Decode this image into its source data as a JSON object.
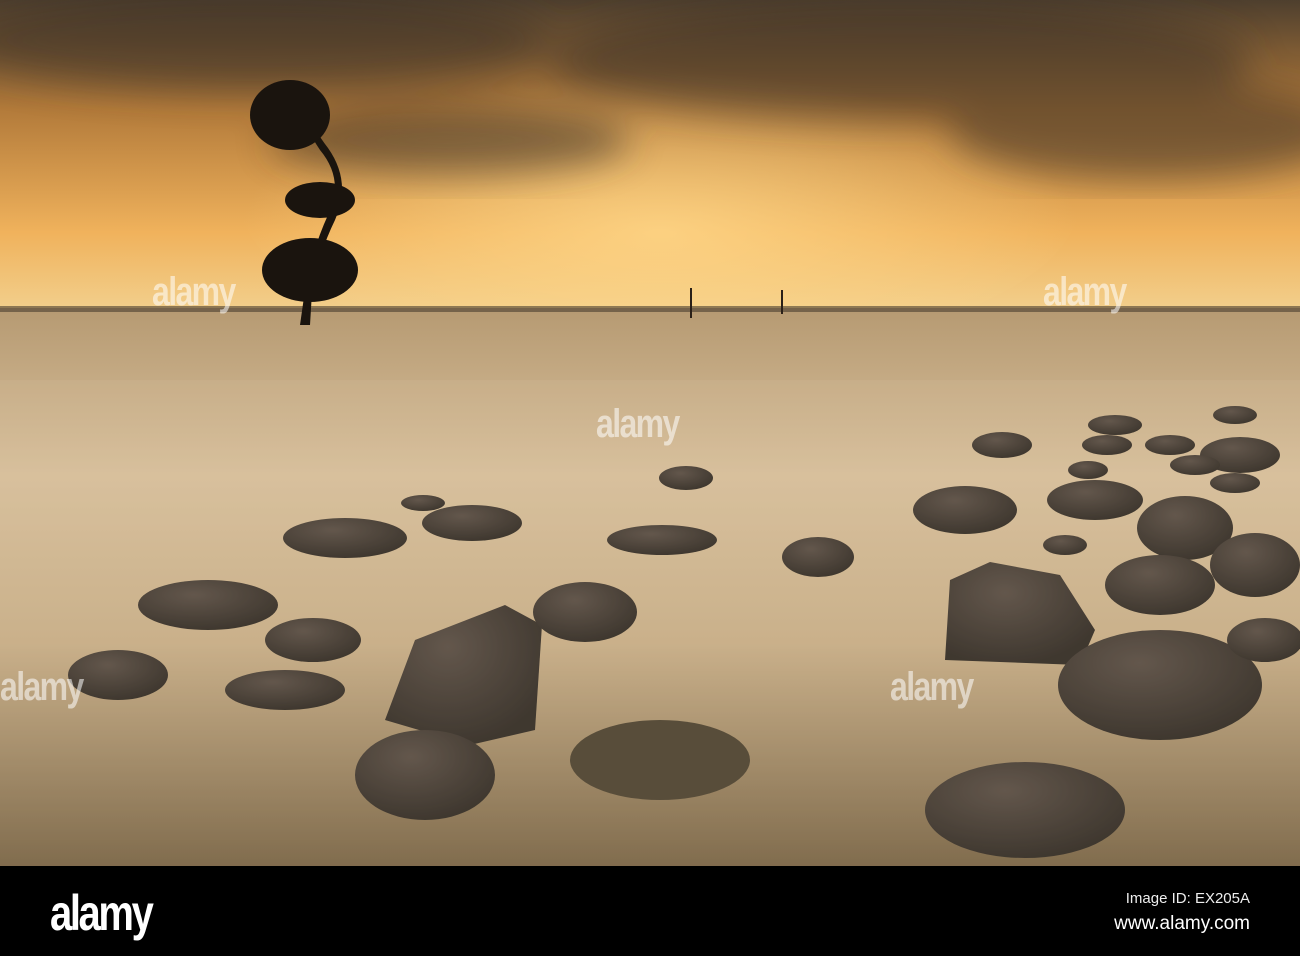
{
  "photo": {
    "watermark_text": "alamy",
    "colors": {
      "sky_top": "#5a4a36",
      "sky_glow": "#f0b860",
      "horizon": "#e8c890",
      "water": "#c9b08a",
      "rock": "#2e2824"
    }
  },
  "footer": {
    "logo": "alamy",
    "image_id": "Image ID: EX205A",
    "website": "www.alamy.com"
  }
}
